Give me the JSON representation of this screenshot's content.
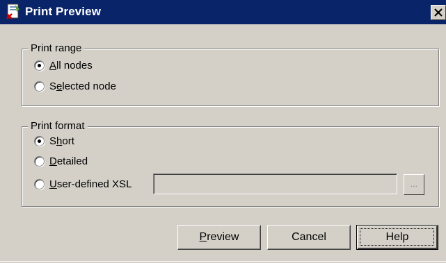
{
  "window": {
    "title": "Print Preview",
    "icon": "print-preview-app-icon",
    "close_icon": "close-icon"
  },
  "print_range": {
    "legend": "Print range",
    "options": [
      {
        "label_pre": "",
        "mnemonic": "A",
        "label_post": "ll nodes",
        "checked": true
      },
      {
        "label_pre": "S",
        "mnemonic": "e",
        "label_post": "lected node",
        "checked": false
      }
    ]
  },
  "print_format": {
    "legend": "Print format",
    "options": [
      {
        "label_pre": "S",
        "mnemonic": "h",
        "label_post": "ort",
        "checked": true
      },
      {
        "label_pre": "",
        "mnemonic": "D",
        "label_post": "etailed",
        "checked": false
      },
      {
        "label_pre": "",
        "mnemonic": "U",
        "label_post": "ser-defined XSL",
        "checked": false
      }
    ],
    "xsl_value": "",
    "browse_label": "..."
  },
  "buttons": {
    "preview": {
      "mnemonic": "P",
      "rest": "review"
    },
    "cancel": "Cancel",
    "help": "Help"
  },
  "colors": {
    "titlebar": "#0a246a",
    "face": "#d4d0c8"
  }
}
